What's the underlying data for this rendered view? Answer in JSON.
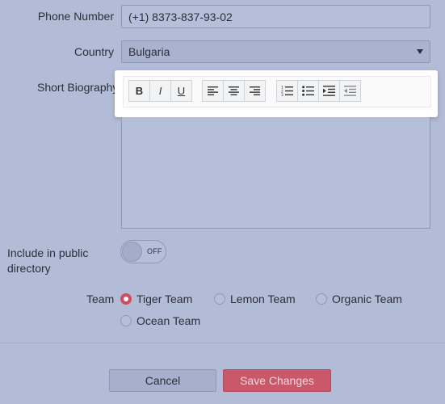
{
  "form": {
    "phone": {
      "label": "Phone Number",
      "value": "(+1) 8373-837-93-02"
    },
    "country": {
      "label": "Country",
      "value": "Bulgaria"
    },
    "bio": {
      "label": "Short Biography",
      "toolbar": {
        "bold": "B",
        "italic": "I",
        "underline": "U"
      }
    },
    "public_directory": {
      "label": "Include in public directory",
      "state": "OFF"
    },
    "team": {
      "label": "Team",
      "options": [
        {
          "label": "Tiger Team",
          "checked": true
        },
        {
          "label": "Lemon Team",
          "checked": false
        },
        {
          "label": "Organic Team",
          "checked": false
        },
        {
          "label": "Ocean Team",
          "checked": false
        }
      ]
    }
  },
  "actions": {
    "cancel": "Cancel",
    "save": "Save Changes"
  },
  "colors": {
    "background": "#b3bcd6",
    "accent": "#d24b5e",
    "save_button": "#c9586a"
  },
  "icons": [
    "bold-icon",
    "italic-icon",
    "underline-icon",
    "align-left-icon",
    "align-center-icon",
    "align-right-icon",
    "ordered-list-icon",
    "unordered-list-icon",
    "indent-icon",
    "outdent-icon",
    "dropdown-caret-icon"
  ]
}
